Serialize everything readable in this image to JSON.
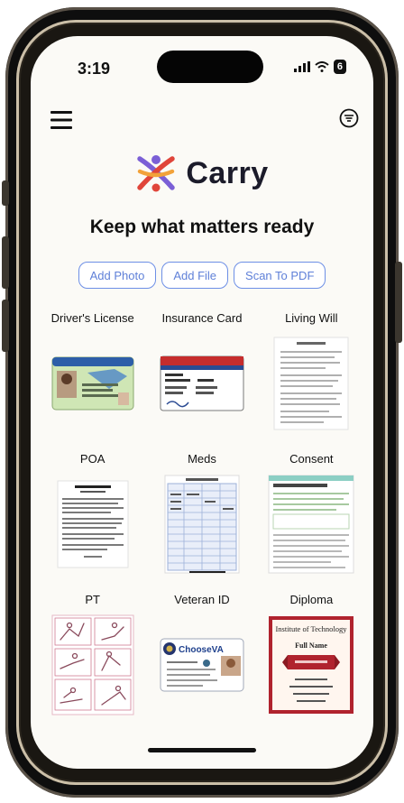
{
  "status": {
    "time": "3:19",
    "battery": "6"
  },
  "header": {
    "brand": "Carry",
    "tagline": "Keep what matters ready"
  },
  "actions": [
    "Add Photo",
    "Add File",
    "Scan To PDF"
  ],
  "documents": [
    {
      "label": "Driver's License"
    },
    {
      "label": "Insurance Card"
    },
    {
      "label": "Living Will"
    },
    {
      "label": "POA"
    },
    {
      "label": "Meds"
    },
    {
      "label": "Consent"
    },
    {
      "label": "PT"
    },
    {
      "label": "Veteran ID",
      "thumb_text": "ChooseVA"
    },
    {
      "label": "Diploma",
      "thumb_title": "Institute of Technology",
      "thumb_name": "Full Name"
    }
  ],
  "colors": {
    "accent": "#6d8fe6",
    "brand_dark": "#1b1b2a",
    "logo": [
      "#7b5fd6",
      "#e0453a",
      "#f2a23a"
    ]
  }
}
